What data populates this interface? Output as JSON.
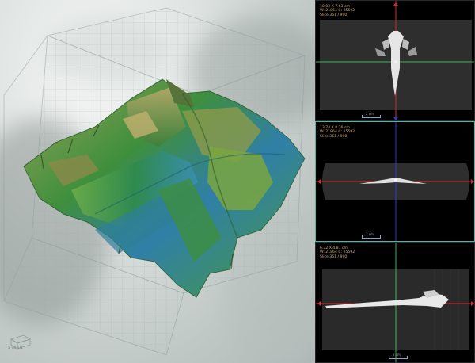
{
  "viewer3d": {
    "orientation_icon": "orientation-cube-icon",
    "orientation_label": "STERN"
  },
  "slices": [
    {
      "dims": "10.02 X 7.63 cm",
      "wl": "W: 21864 C: 25592",
      "slice": "Slice 361 / 990",
      "scale": "2 cm"
    },
    {
      "dims": "13.74 X 8.16 cm",
      "wl": "W: 21864 C: 25592",
      "slice": "Slice 361 / 990",
      "scale": "2 cm"
    },
    {
      "dims": "6.32 X 4.81 cm",
      "wl": "W: 21864 C: 25592",
      "slice": "Slice 361 / 990",
      "scale": "2 cm"
    }
  ],
  "colors": {
    "crosshair_horizontal": "#d62a2a",
    "crosshair_vertical": "#2a3ed6",
    "crosshair_green": "#2cc04a",
    "active_border": "#4fb7a8"
  }
}
